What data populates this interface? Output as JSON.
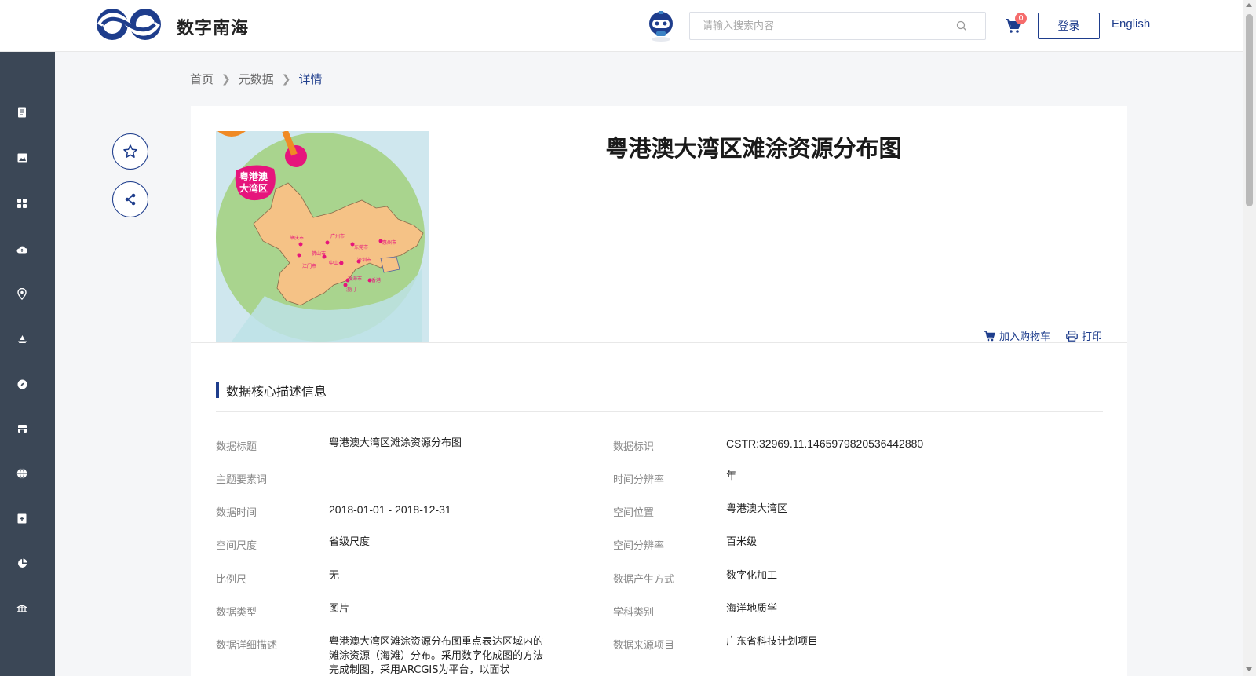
{
  "header": {
    "site_name": "数字南海",
    "search_placeholder": "请输入搜索内容",
    "cart_count": "0",
    "login_label": "登录",
    "lang_label": "English"
  },
  "sidebar": {
    "items": [
      {
        "icon": "document-icon"
      },
      {
        "icon": "image-icon"
      },
      {
        "icon": "grid-icon"
      },
      {
        "icon": "cloud-upload-icon"
      },
      {
        "icon": "location-pin-icon"
      },
      {
        "icon": "ship-icon"
      },
      {
        "icon": "compass-icon"
      },
      {
        "icon": "store-icon"
      },
      {
        "icon": "globe-icon"
      },
      {
        "icon": "add-box-icon"
      },
      {
        "icon": "pie-chart-icon"
      },
      {
        "icon": "bridge-icon"
      }
    ]
  },
  "breadcrumb": {
    "home": "首页",
    "metadata": "元数据",
    "current": "详情"
  },
  "detail": {
    "title": "粤港澳大湾区滩涂资源分布图",
    "thumbnail_label": "粤港澳大湾区",
    "add_to_cart": "加入购物车",
    "print": "打印",
    "section_title": "数据核心描述信息",
    "fields_left": [
      {
        "label": "数据标题",
        "value": "粤港澳大湾区滩涂资源分布图"
      },
      {
        "label": "主题要素词",
        "value": ""
      },
      {
        "label": "数据时间",
        "value": "2018-01-01 - 2018-12-31"
      },
      {
        "label": "空间尺度",
        "value": "省级尺度"
      },
      {
        "label": "比例尺",
        "value": "无"
      },
      {
        "label": "数据类型",
        "value": "图片"
      },
      {
        "label": "数据详细描述",
        "value": "粤港澳大湾区滩涂资源分布图重点表达区域内的滩涂资源（海滩）分布。采用数字化成图的方法完成制图，采用ARCGIS为平台，以面状"
      }
    ],
    "fields_right": [
      {
        "label": "数据标识",
        "value": "CSTR:32969.11.1465979820536442880"
      },
      {
        "label": "时间分辨率",
        "value": "年"
      },
      {
        "label": "空间位置",
        "value": "粤港澳大湾区"
      },
      {
        "label": "空间分辨率",
        "value": "百米级"
      },
      {
        "label": "数据产生方式",
        "value": "数字化加工"
      },
      {
        "label": "学科类别",
        "value": "海洋地质学"
      },
      {
        "label": "数据来源项目",
        "value": "广东省科技计划项目"
      }
    ],
    "city_labels": [
      "肇庆市",
      "广州市",
      "佛山市",
      "东莞市",
      "惠州市",
      "江门市",
      "中山市",
      "深圳市",
      "珠海市",
      "香港",
      "澳门"
    ]
  },
  "colors": {
    "primary": "#1e3d8c",
    "sidebar_bg": "#3b4756",
    "badge": "#f56c6c"
  }
}
